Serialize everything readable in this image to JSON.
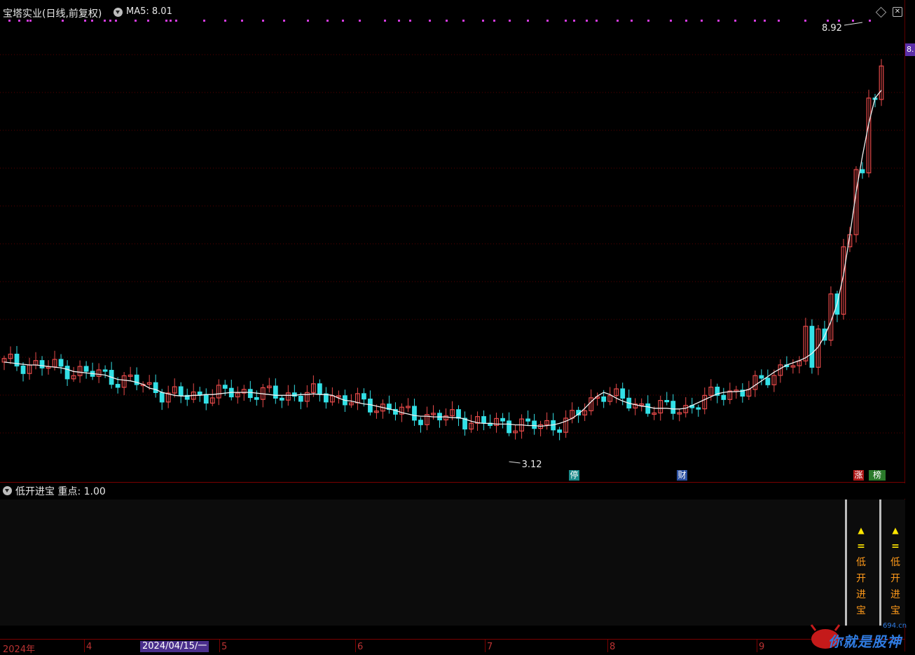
{
  "header": {
    "title": "宝塔实业(日线,前复权)",
    "ma_label": "MA5: 8.01"
  },
  "price_flag": "8.",
  "annotations": {
    "high": "8.92",
    "low": "3.12"
  },
  "events": [
    {
      "label": "停",
      "color": "#1a8a8a"
    },
    {
      "label": "财",
      "color": "#2a4fa0"
    },
    {
      "label": "涨",
      "color": "#b01818"
    },
    {
      "label": "榜",
      "color": "#2a7a2a"
    }
  ],
  "indicator": {
    "title": "低开进宝  重点: 1.00",
    "signals": [
      {
        "icon": "▲",
        "eq": "=",
        "chars": [
          "低",
          "开",
          "进",
          "宝"
        ]
      },
      {
        "icon": "▲",
        "eq": "=",
        "chars": [
          "低",
          "开",
          "进",
          "宝"
        ]
      }
    ]
  },
  "time_axis": {
    "ticks": [
      "2024年",
      "4",
      "5",
      "6",
      "7",
      "8",
      "9"
    ],
    "cursor_date": "2024/04/15/一"
  },
  "colors": {
    "up": "#e84a4a",
    "down": "#33e0e6",
    "ma": "#f0f0f0",
    "marker": "#d43be0"
  },
  "watermark": {
    "text": "你就是股神",
    "small": "694.cn"
  },
  "chart_data": {
    "type": "candlestick",
    "title": "宝塔实业(日线,前复权)",
    "ylim": [
      2.85,
      8.95
    ],
    "series": [
      {
        "name": "MA5",
        "values": [
          4.24,
          4.23,
          4.22,
          4.21,
          4.2,
          4.2,
          4.19,
          4.18,
          4.17,
          4.16,
          4.14,
          4.11,
          4.1,
          4.09,
          4.08,
          4.07,
          4.06,
          4.03,
          4.0,
          3.99,
          3.98,
          3.96,
          3.93,
          3.88,
          3.86,
          3.82,
          3.8,
          3.78,
          3.77,
          3.77,
          3.78,
          3.78,
          3.79,
          3.79,
          3.8,
          3.81,
          3.82,
          3.82,
          3.82,
          3.82,
          3.81,
          3.8,
          3.79,
          3.78,
          3.78,
          3.78,
          3.78,
          3.79,
          3.79,
          3.8,
          3.79,
          3.79,
          3.78,
          3.74,
          3.71,
          3.7,
          3.68,
          3.66,
          3.65,
          3.63,
          3.61,
          3.59,
          3.57,
          3.54,
          3.52,
          3.5,
          3.49,
          3.49,
          3.48,
          3.48,
          3.48,
          3.47,
          3.47,
          3.45,
          3.42,
          3.4,
          3.39,
          3.39,
          3.38,
          3.38,
          3.38,
          3.37,
          3.37,
          3.36,
          3.36,
          3.35,
          3.36,
          3.37,
          3.39,
          3.42,
          3.46,
          3.52,
          3.6,
          3.69,
          3.77,
          3.82,
          3.79,
          3.74,
          3.7,
          3.67,
          3.65,
          3.63,
          3.62,
          3.6,
          3.6,
          3.6,
          3.59,
          3.59,
          3.6,
          3.64,
          3.68,
          3.72,
          3.76,
          3.8,
          3.82,
          3.83,
          3.83,
          3.84,
          3.86,
          3.92,
          3.98,
          4.04,
          4.1,
          4.15,
          4.2,
          4.23,
          4.26,
          4.3,
          4.36,
          4.45,
          4.6,
          4.8,
          5.05,
          5.45,
          6.0,
          6.6,
          7.1,
          7.55,
          7.9,
          8.01
        ]
      }
    ]
  }
}
